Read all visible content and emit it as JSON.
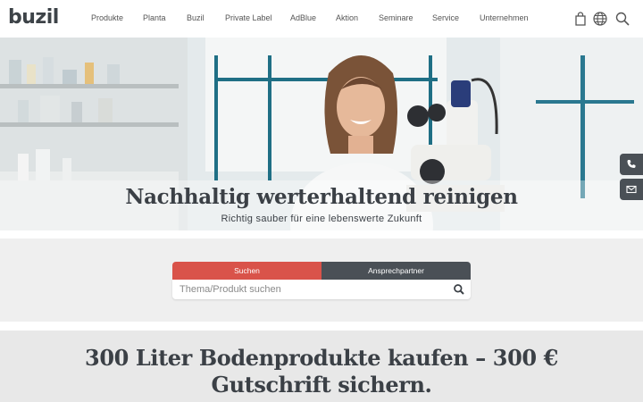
{
  "header": {
    "logo": "buzil",
    "nav": [
      {
        "label": "Produkte"
      },
      {
        "label": "Planta"
      },
      {
        "label": "Buzil"
      },
      {
        "label": "Private Label"
      },
      {
        "label": "AdBlue"
      },
      {
        "label": "Aktion"
      },
      {
        "label": "Seminare"
      },
      {
        "label": "Service"
      },
      {
        "label": "Unternehmen"
      }
    ],
    "icons": [
      "shopping-bag-icon",
      "globe-icon",
      "search-icon"
    ]
  },
  "hero": {
    "title": "Nachhaltig werterhaltend reinigen",
    "subtitle": "Richtig sauber für eine lebenswerte Zukunft"
  },
  "side_contact": {
    "icons": [
      "phone-icon",
      "mail-icon"
    ]
  },
  "search": {
    "tabs": [
      {
        "label": "Suchen",
        "active": true
      },
      {
        "label": "Ansprechpartner",
        "active": false
      }
    ],
    "placeholder": "Thema/Produkt suchen",
    "value": ""
  },
  "promo": {
    "line1": "300 Liter Bodenprodukte kaufen – 300 €",
    "line2": "Gutschrift sichern."
  },
  "colors": {
    "accent_red": "#d9534a",
    "dark_gray": "#4a5056",
    "text_dark": "#3b4046"
  }
}
